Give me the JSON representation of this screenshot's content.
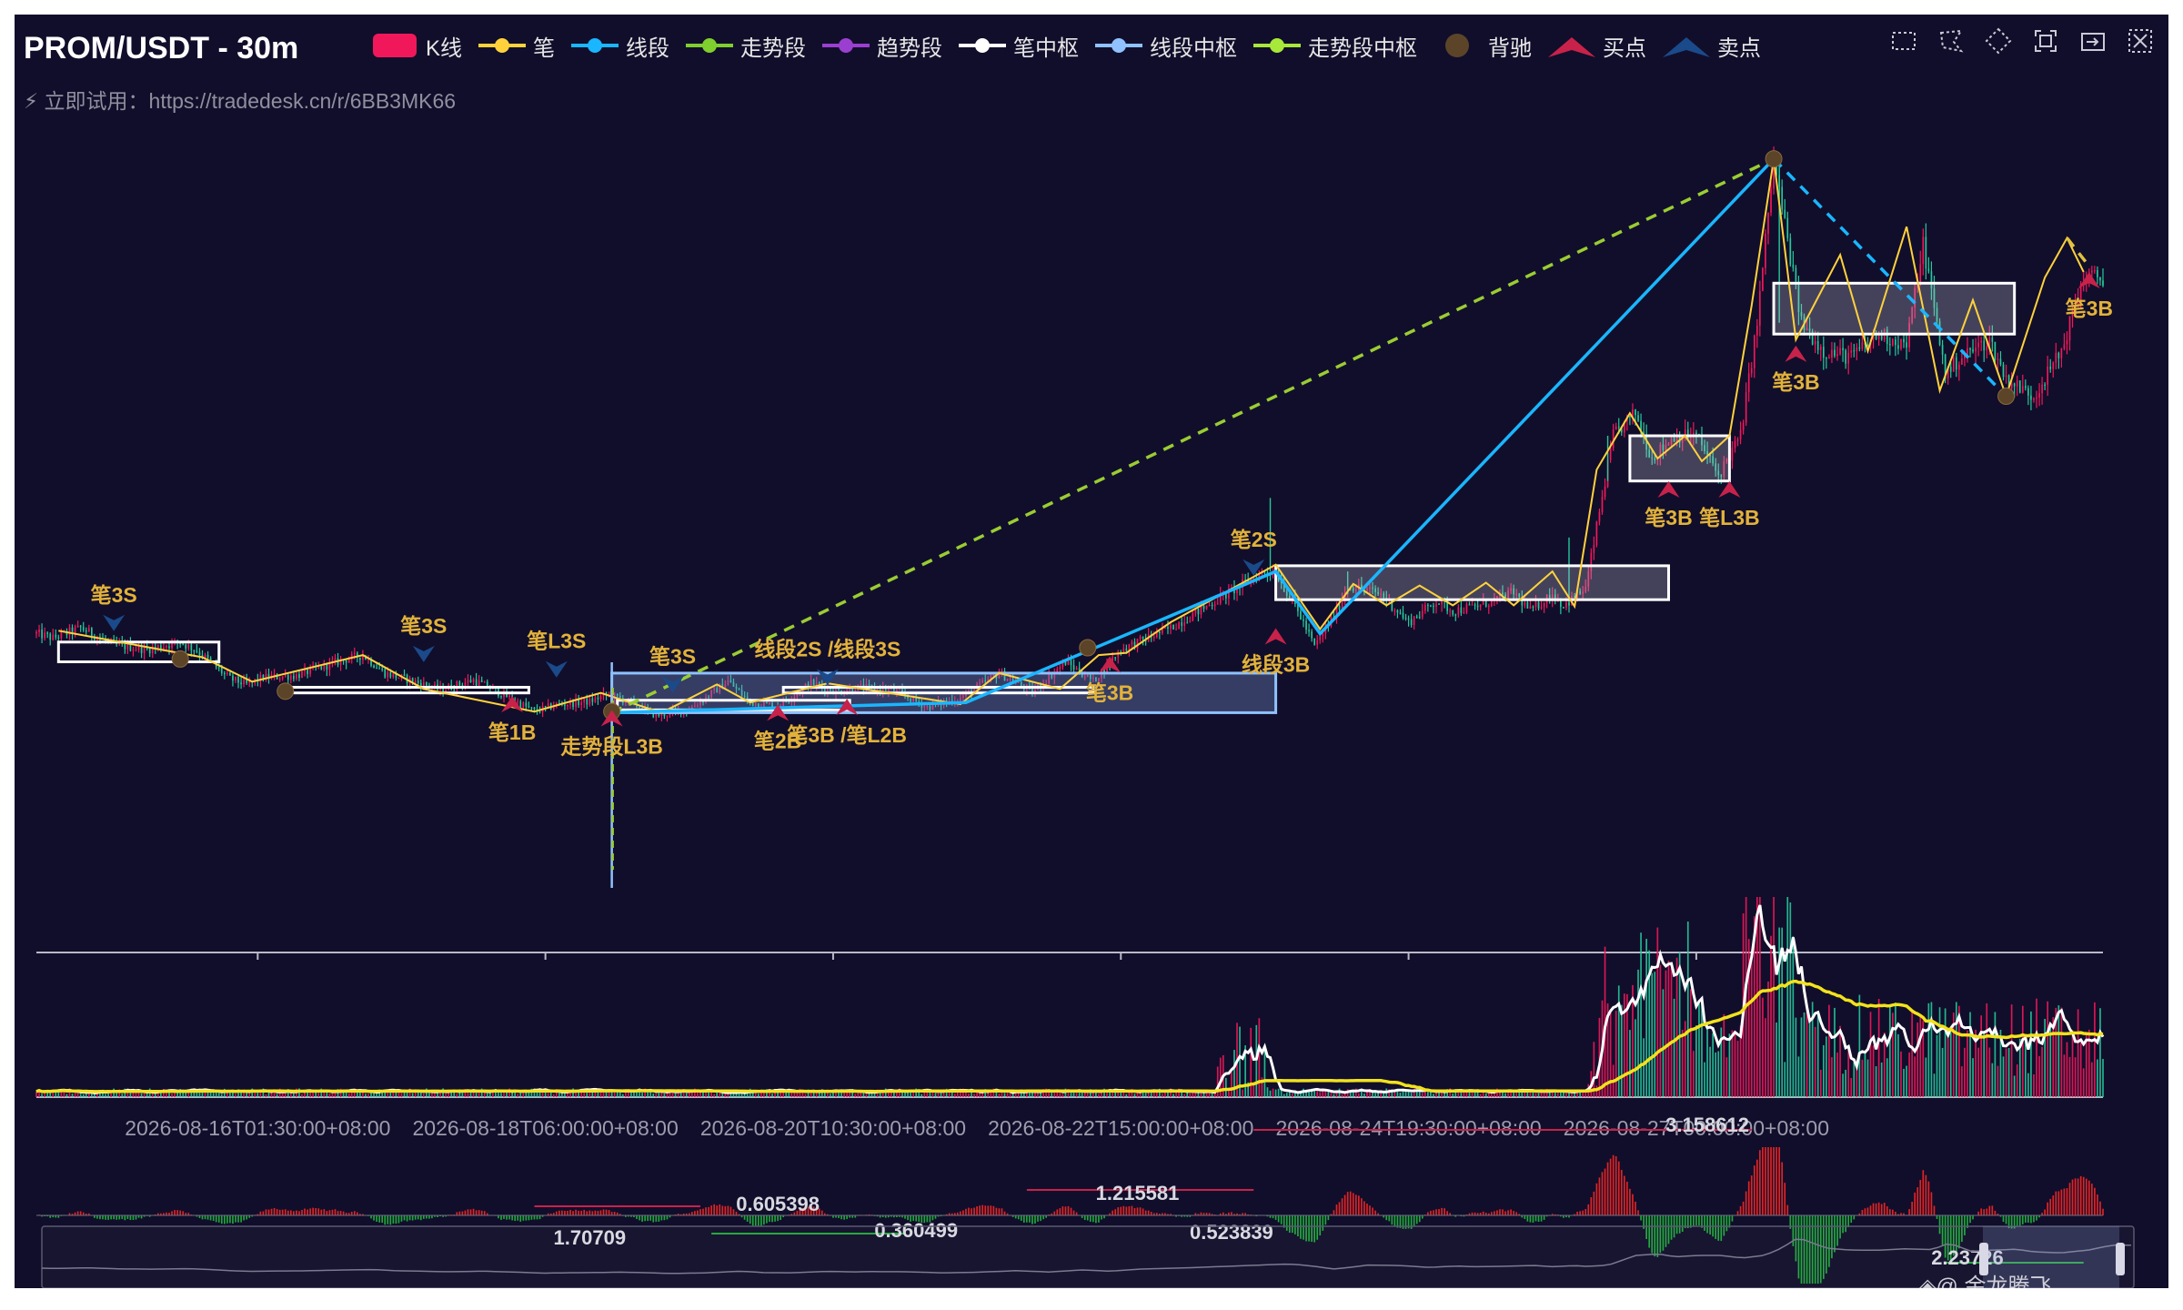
{
  "title": "PROM/USDT - 30m",
  "subtitle": "⚡ 立即试用：https://tradedesk.cn/r/6BB3MK66",
  "watermark": "◈@ 金龙腾飞_TradeDesk",
  "colors": {
    "background": "#110e2b",
    "kline_up": "#f0185a",
    "kline_down": "#26c99b",
    "bi": "#ffd23c",
    "xianduan": "#1ab6ff",
    "zoushi": "#7fcf2f",
    "qushi": "#9b3fd0",
    "bi_zs": "#ffffff",
    "xd_zs": "#8fc2ff",
    "zs_zs": "#a8e83a",
    "divergence": "#5c4429",
    "buy": "#c8224a",
    "sell": "#1b4a8a"
  },
  "legend": [
    {
      "label": "K线",
      "shape": "rect",
      "color": "#f0185a"
    },
    {
      "label": "笔",
      "shape": "line",
      "color": "#ffd23c"
    },
    {
      "label": "线段",
      "shape": "line",
      "color": "#1ab6ff"
    },
    {
      "label": "走势段",
      "shape": "line",
      "color": "#7fcf2f"
    },
    {
      "label": "趋势段",
      "shape": "line",
      "color": "#9b3fd0"
    },
    {
      "label": "笔中枢",
      "shape": "line",
      "color": "#ffffff"
    },
    {
      "label": "线段中枢",
      "shape": "line",
      "color": "#8fc2ff"
    },
    {
      "label": "走势段中枢",
      "shape": "line",
      "color": "#a8e83a"
    },
    {
      "label": "背驰",
      "shape": "circle",
      "color": "#5c4429"
    },
    {
      "label": "买点",
      "shape": "tri-up",
      "color": "#c8224a"
    },
    {
      "label": "卖点",
      "shape": "tri-up",
      "color": "#1b4a8a"
    }
  ],
  "toolbox": [
    {
      "name": "rect-zoom-icon"
    },
    {
      "name": "lasso-select-icon"
    },
    {
      "name": "polygon-select-icon"
    },
    {
      "name": "expand-view-icon"
    },
    {
      "name": "restore-view-icon"
    },
    {
      "name": "clear-select-icon"
    }
  ],
  "chart_data": {
    "type": "candlestick",
    "x_axis": {
      "tick_labels": [
        "2026-08-16T01:30:00+08:00",
        "2026-08-18T06:00:00+08:00",
        "2026-08-20T10:30:00+08:00",
        "2026-08-22T15:00:00+08:00",
        "2026-08-24T19:30:00+08:00",
        "2026-08-27T00:00:00+08:00"
      ],
      "tick_positions": [
        80,
        184,
        288,
        392,
        496,
        600
      ]
    },
    "y_range": [
      0.3,
      1.62
    ],
    "price_path": [
      [
        0,
        0.75
      ],
      [
        6,
        0.742
      ],
      [
        16,
        0.76
      ],
      [
        28,
        0.73
      ],
      [
        40,
        0.722
      ],
      [
        52,
        0.735
      ],
      [
        58,
        0.72
      ],
      [
        70,
        0.67
      ],
      [
        76,
        0.66
      ],
      [
        82,
        0.672
      ],
      [
        94,
        0.676
      ],
      [
        110,
        0.702
      ],
      [
        118,
        0.712
      ],
      [
        126,
        0.68
      ],
      [
        138,
        0.663
      ],
      [
        146,
        0.65
      ],
      [
        158,
        0.668
      ],
      [
        172,
        0.634
      ],
      [
        180,
        0.612
      ],
      [
        188,
        0.624
      ],
      [
        200,
        0.63
      ],
      [
        206,
        0.642
      ],
      [
        214,
        0.63
      ],
      [
        224,
        0.605
      ],
      [
        236,
        0.616
      ],
      [
        244,
        0.644
      ],
      [
        250,
        0.666
      ],
      [
        258,
        0.628
      ],
      [
        268,
        0.622
      ],
      [
        280,
        0.662
      ],
      [
        290,
        0.647
      ],
      [
        296,
        0.655
      ],
      [
        310,
        0.65
      ],
      [
        322,
        0.62
      ],
      [
        334,
        0.636
      ],
      [
        348,
        0.68
      ],
      [
        360,
        0.646
      ],
      [
        372,
        0.7
      ],
      [
        382,
        0.666
      ],
      [
        392,
        0.722
      ],
      [
        410,
        0.76
      ],
      [
        432,
        0.825
      ],
      [
        444,
        0.86
      ],
      [
        448,
        0.858
      ],
      [
        456,
        0.79
      ],
      [
        462,
        0.727
      ],
      [
        470,
        0.79
      ],
      [
        474,
        0.836
      ],
      [
        486,
        0.82
      ],
      [
        496,
        0.77
      ],
      [
        506,
        0.808
      ],
      [
        512,
        0.79
      ],
      [
        522,
        0.8
      ],
      [
        534,
        0.823
      ],
      [
        540,
        0.79
      ],
      [
        548,
        0.82
      ],
      [
        552,
        0.799
      ],
      [
        560,
        0.83
      ],
      [
        570,
        1.1
      ],
      [
        578,
        1.14
      ],
      [
        584,
        1.06
      ],
      [
        592,
        1.1
      ],
      [
        600,
        1.1
      ],
      [
        608,
        1.03
      ],
      [
        616,
        1.1
      ],
      [
        622,
        1.3
      ],
      [
        628,
        1.59
      ],
      [
        638,
        1.3
      ],
      [
        646,
        1.25
      ],
      [
        656,
        1.24
      ],
      [
        666,
        1.28
      ],
      [
        676,
        1.26
      ],
      [
        682,
        1.44
      ],
      [
        690,
        1.21
      ],
      [
        696,
        1.24
      ],
      [
        706,
        1.27
      ],
      [
        712,
        1.2
      ],
      [
        722,
        1.17
      ],
      [
        732,
        1.25
      ],
      [
        740,
        1.38
      ],
      [
        746,
        1.38
      ]
    ],
    "bi": [
      [
        8,
        0.755
      ],
      [
        60,
        0.708
      ],
      [
        78,
        0.665
      ],
      [
        118,
        0.712
      ],
      [
        140,
        0.652
      ],
      [
        180,
        0.612
      ],
      [
        204,
        0.645
      ],
      [
        226,
        0.61
      ],
      [
        246,
        0.66
      ],
      [
        258,
        0.628
      ],
      [
        286,
        0.662
      ],
      [
        334,
        0.625
      ],
      [
        348,
        0.68
      ],
      [
        370,
        0.652
      ],
      [
        384,
        0.712
      ],
      [
        394,
        0.716
      ],
      [
        410,
        0.77
      ],
      [
        448,
        0.872
      ],
      [
        464,
        0.758
      ],
      [
        476,
        0.838
      ],
      [
        488,
        0.8
      ],
      [
        500,
        0.835
      ],
      [
        512,
        0.8
      ],
      [
        524,
        0.84
      ],
      [
        534,
        0.8
      ],
      [
        548,
        0.86
      ],
      [
        556,
        0.798
      ],
      [
        564,
        1.04
      ],
      [
        576,
        1.14
      ],
      [
        586,
        1.06
      ],
      [
        596,
        1.1
      ],
      [
        602,
        1.055
      ],
      [
        612,
        1.1
      ],
      [
        620,
        1.33
      ],
      [
        628,
        1.59
      ],
      [
        636,
        1.27
      ],
      [
        652,
        1.42
      ],
      [
        662,
        1.25
      ],
      [
        676,
        1.47
      ],
      [
        688,
        1.18
      ],
      [
        700,
        1.34
      ],
      [
        712,
        1.17
      ],
      [
        726,
        1.38
      ],
      [
        734,
        1.45
      ],
      [
        740,
        1.39
      ]
    ],
    "xianduan": [
      {
        "points": [
          [
            208,
            0.61
          ],
          [
            336,
            0.628
          ],
          [
            448,
            0.86
          ],
          [
            464,
            0.75
          ],
          [
            628,
            1.59
          ]
        ],
        "dashed": false
      },
      {
        "points": [
          [
            628,
            1.59
          ],
          [
            712,
            1.17
          ]
        ],
        "dashed": true
      }
    ],
    "zoushi": [
      {
        "points": [
          [
            208,
            0.61
          ],
          [
            628,
            1.59
          ]
        ],
        "dashed": true
      },
      {
        "points": [
          [
            734,
            1.45
          ],
          [
            742,
            1.4
          ]
        ],
        "dashed": true
      }
    ],
    "bi_zs": [
      {
        "x0": 8,
        "x1": 66,
        "y0": 0.7,
        "y1": 0.735,
        "filled": false
      },
      {
        "x0": 90,
        "x1": 178,
        "y0": 0.645,
        "y1": 0.655,
        "filled": false
      },
      {
        "x0": 210,
        "x1": 294,
        "y0": 0.615,
        "y1": 0.632,
        "filled": false
      },
      {
        "x0": 270,
        "x1": 382,
        "y0": 0.645,
        "y1": 0.655,
        "filled": false
      },
      {
        "x0": 448,
        "x1": 590,
        "y0": 0.81,
        "y1": 0.87,
        "filled": true
      },
      {
        "x0": 576,
        "x1": 612,
        "y0": 1.02,
        "y1": 1.1,
        "filled": true
      },
      {
        "x0": 628,
        "x1": 715,
        "y0": 1.28,
        "y1": 1.37,
        "filled": true
      }
    ],
    "xd_zs": [
      {
        "x0": 208,
        "x1": 448,
        "y0": 0.61,
        "y1": 0.68
      }
    ],
    "divergence_points": [
      [
        52,
        0.705
      ],
      [
        90,
        0.648
      ],
      [
        208,
        0.612
      ],
      [
        380,
        0.725
      ],
      [
        628,
        1.59
      ],
      [
        712,
        1.17
      ]
    ],
    "buy_points": [
      {
        "x": 172,
        "y": 0.63,
        "label": "笔1B"
      },
      {
        "x": 208,
        "y": 0.605,
        "label": "走势段L3B"
      },
      {
        "x": 268,
        "y": 0.615,
        "label": "笔2B"
      },
      {
        "x": 293,
        "y": 0.625,
        "label": "笔3B /笔L2B"
      },
      {
        "x": 388,
        "y": 0.7,
        "label": "笔3B"
      },
      {
        "x": 448,
        "y": 0.75,
        "label": "线段3B"
      },
      {
        "x": 590,
        "y": 1.01,
        "label": "笔3B"
      },
      {
        "x": 612,
        "y": 1.01,
        "label": "笔L3B"
      },
      {
        "x": 636,
        "y": 1.25,
        "label": "笔3B"
      },
      {
        "x": 742,
        "y": 1.38,
        "label": "笔3B"
      }
    ],
    "sell_points": [
      {
        "x": 28,
        "y": 0.764,
        "label": "笔3S"
      },
      {
        "x": 140,
        "y": 0.709,
        "label": "笔3S"
      },
      {
        "x": 188,
        "y": 0.682,
        "label": "笔L3S"
      },
      {
        "x": 230,
        "y": 0.655,
        "label": "笔3S"
      },
      {
        "x": 286,
        "y": 0.668,
        "label": "线段2S /线段3S"
      },
      {
        "x": 440,
        "y": 0.862,
        "label": "笔2S"
      }
    ],
    "macd_annotations": [
      {
        "x": 200,
        "label": "1.70709"
      },
      {
        "x": 268,
        "label": "0.605398"
      },
      {
        "x": 318,
        "label": "0.360499"
      },
      {
        "x": 398,
        "label": "1.215581"
      },
      {
        "x": 432,
        "label": "0.523839"
      },
      {
        "x": 604,
        "label": "3.158612"
      },
      {
        "x": 698,
        "label": "2.23726"
      }
    ]
  }
}
